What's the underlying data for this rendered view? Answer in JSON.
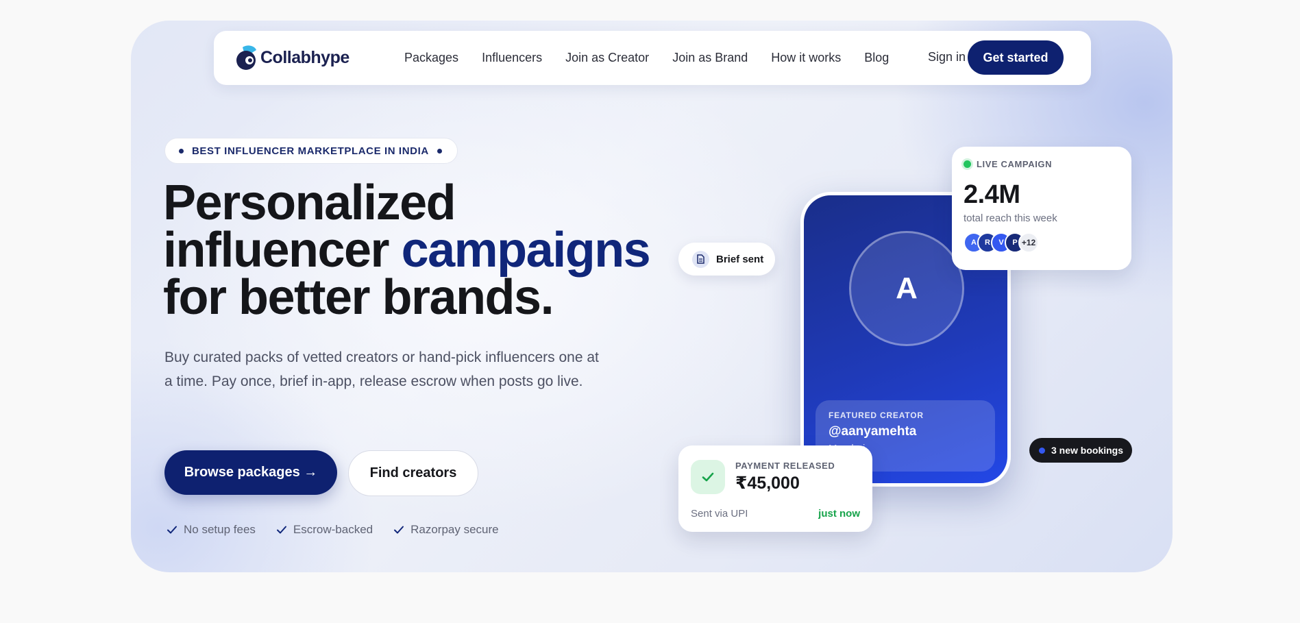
{
  "brand": {
    "name": "Collabhype"
  },
  "nav": {
    "links": [
      "Packages",
      "Influencers",
      "Join as Creator",
      "Join as Brand",
      "How it works",
      "Blog"
    ],
    "signin": "Sign in",
    "cta": "Get started"
  },
  "hero": {
    "badge": "BEST INFLUENCER MARKETPLACE IN INDIA",
    "headline_part1": "Personalized",
    "headline_part2": "influencer ",
    "headline_accent": "campaigns",
    "headline_part3": "for better brands.",
    "subtext": "Buy curated packs of vetted creators or hand-pick influencers one at a time. Pay once, brief in-app, release escrow when posts go live.",
    "primary_button": "Browse packages →",
    "secondary_button": "Find creators",
    "checks": [
      "No setup fees",
      "Escrow-backed",
      "Razorpay secure"
    ]
  },
  "visual": {
    "phone": {
      "avatar_letter": "A",
      "featured_label": "FEATURED CREATOR",
      "handle": "@aanyamehta",
      "city": "Mumbai"
    },
    "brief_pill": "Brief sent",
    "live_card": {
      "label": "LIVE CAMPAIGN",
      "reach": "2.4M",
      "sub": "total reach this week",
      "avatars": [
        {
          "letter": "A",
          "color": "#3f66f0"
        },
        {
          "letter": "R",
          "color": "#1f3a9e"
        },
        {
          "letter": "V",
          "color": "#3458f0"
        },
        {
          "letter": "P",
          "color": "#182a78"
        }
      ],
      "more": "+12"
    },
    "bookings_pill": "3 new bookings",
    "payment_card": {
      "label": "PAYMENT RELEASED",
      "amount": "₹45,000",
      "method": "Sent via UPI",
      "time": "just now"
    }
  },
  "colors": {
    "primary": "#0e2170",
    "accent_text": "#10267a",
    "success": "#16a34a",
    "live_dot": "#22c55e"
  }
}
